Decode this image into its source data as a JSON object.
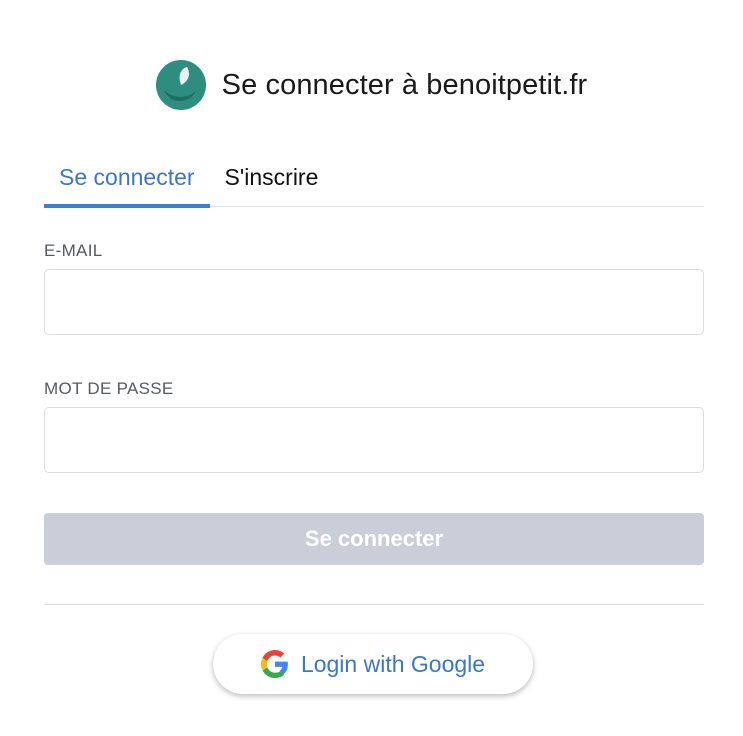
{
  "header": {
    "title": "Se connecter à benoitpetit.fr",
    "logo_icon": "leaf-logo-icon",
    "logo_colors": [
      "#2f8d80",
      "#1d6e63",
      "#e8f3f0"
    ]
  },
  "tabs": [
    {
      "label": "Se connecter",
      "active": true
    },
    {
      "label": "S'inscrire",
      "active": false
    }
  ],
  "form": {
    "email": {
      "label": "E-MAIL",
      "value": "",
      "placeholder": ""
    },
    "password": {
      "label": "MOT DE PASSE",
      "value": "",
      "placeholder": ""
    },
    "submit_label": "Se connecter",
    "submit_state": "disabled"
  },
  "google": {
    "label": "Login with Google",
    "icon": "google-g-icon"
  },
  "colors": {
    "accent": "#3a77c8",
    "tab_underline": "#3a7fd6",
    "disabled_button": "#c9ced8",
    "border": "#d9dce0"
  }
}
